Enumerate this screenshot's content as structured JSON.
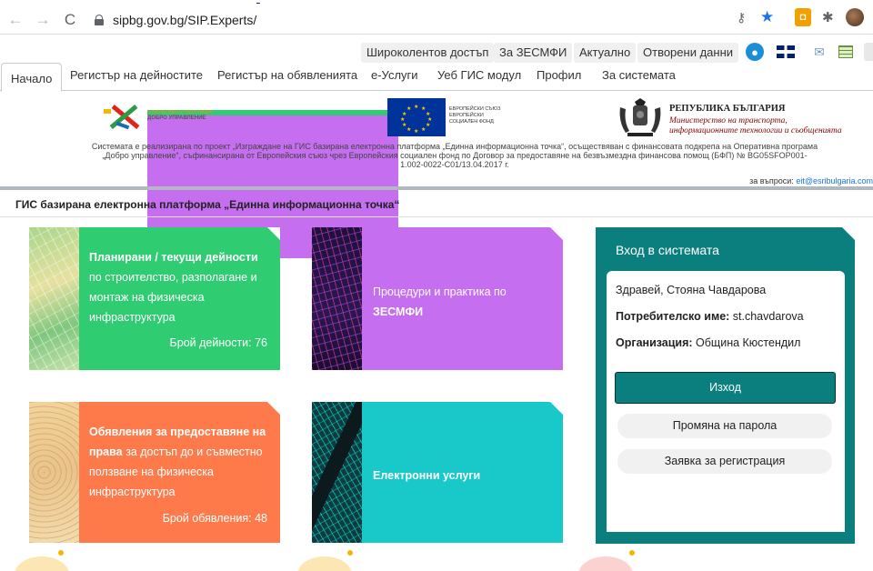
{
  "browser": {
    "url": "sipbg.gov.bg/SIP.Experts/",
    "back": "←",
    "forward": "→",
    "reload": "C",
    "icons": [
      "key-icon",
      "star-icon",
      "shopping-bag-icon",
      "puzzle-icon",
      "profile-avatar"
    ]
  },
  "utility": {
    "links": [
      "Широколентов достъп",
      "За ЗЕСМФИ",
      "Актуално",
      "Отворени данни"
    ],
    "icons": [
      "user-icon",
      "uk-flag-icon",
      "mail-icon",
      "table-icon",
      "more-icon"
    ]
  },
  "tabs": [
    "Начало",
    "Регистър на дейностите",
    "Регистър на обявленията",
    "е-Услуги",
    "Уеб ГИС модул",
    "Профил",
    "За системата"
  ],
  "logos": {
    "gg_line1": "ОПЕРАТИВНА ПРОГРАМА",
    "gg_line2": "ДОБРО УПРАВЛЕНИЕ",
    "eu_line1": "ЕВРОПЕЙСКИ СЪЮЗ",
    "eu_line2": "ЕВРОПЕЙСКИ",
    "eu_line3": "СОЦИАЛЕН ФОНД",
    "bg_title": "РЕПУБЛИКА БЪЛГАРИЯ",
    "bg_sub1": "Министерство на транспорта,",
    "bg_sub2": "информационните технологии и съобщенията"
  },
  "project_text": "Системата е реализирана по проект „Изграждане на ГИС базирана електронна платформа „Единна информационна точка“, осъществяван с финансовата подкрепа на Оперативна програма „Добро управление“, съфинансирана от Европейския съюз чрез Европейския социален фонд по Договор за предоставяне на безвъзмездна финансова помощ (БФП) № BG05SFOP001-1.002-0022-C01/13.04.2017 г.",
  "contact": {
    "label": "за въпроси:",
    "email": "eit@esribulgaria.com"
  },
  "heading": "ГИС базирана електронна платформа „Единна информационна точка“",
  "tiles": {
    "activities": {
      "title": "Планирани / текущи дейности",
      "desc": " по строителство, разполагане и монтаж на физическа инфраструктура",
      "count": "Брой дейности: 76"
    },
    "procedures": {
      "text1": "Процедури и практика по ",
      "text2": "ЗЕСМФИ"
    },
    "notices": {
      "title": "Обявления за предоставяне на права",
      "desc": " за достъп до и съвместно ползване на физическа инфраструктура",
      "count": "Брой обявления: 48"
    },
    "eservices": {
      "title": "Електронни услуги"
    }
  },
  "login": {
    "title": "Вход в системата",
    "greeting": "Здравей, Стояна Чавдарова",
    "username_label": "Потребителско име:",
    "username": " st.chavdarova",
    "org_label": "Организация:",
    "org": " Община Кюстендил",
    "logout": "Изход",
    "change_password": "Промяна на парола",
    "registration": "Заявка за регистрация"
  },
  "colors": {
    "activities": "#2fcc71",
    "procedures": "#c56ef0",
    "notices": "#ff7a4a",
    "eservices": "#19c9c9",
    "login": "#0b7f7e"
  }
}
